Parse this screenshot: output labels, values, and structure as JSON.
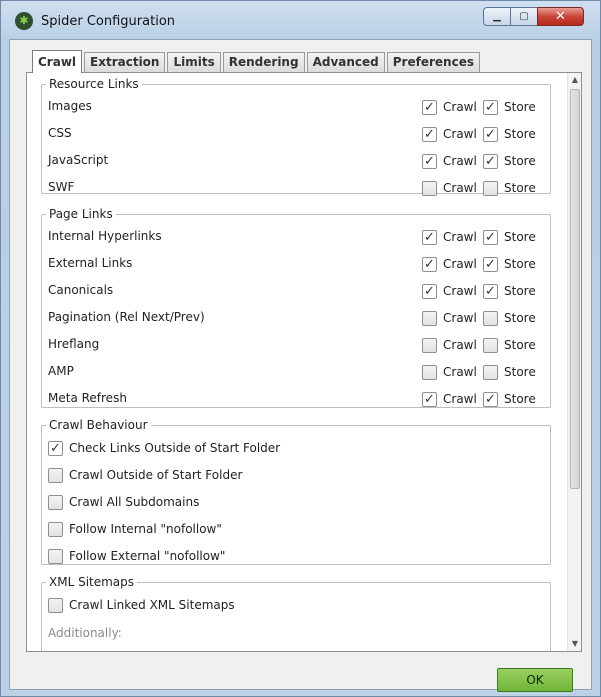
{
  "window": {
    "title": "Spider Configuration",
    "app_icon": "spider-icon"
  },
  "tabs": [
    {
      "label": "Crawl",
      "active": true
    },
    {
      "label": "Extraction",
      "active": false
    },
    {
      "label": "Limits",
      "active": false
    },
    {
      "label": "Rendering",
      "active": false
    },
    {
      "label": "Advanced",
      "active": false
    },
    {
      "label": "Preferences",
      "active": false
    }
  ],
  "resource_links": {
    "title": "Resource Links",
    "crawl_label": "Crawl",
    "store_label": "Store",
    "items": [
      {
        "label": "Images",
        "crawl": true,
        "store": true
      },
      {
        "label": "CSS",
        "crawl": true,
        "store": true
      },
      {
        "label": "JavaScript",
        "crawl": true,
        "store": true
      },
      {
        "label": "SWF",
        "crawl": false,
        "store": false
      }
    ]
  },
  "page_links": {
    "title": "Page Links",
    "crawl_label": "Crawl",
    "store_label": "Store",
    "items": [
      {
        "label": "Internal Hyperlinks",
        "crawl": true,
        "store": true
      },
      {
        "label": "External Links",
        "crawl": true,
        "store": true
      },
      {
        "label": "Canonicals",
        "crawl": true,
        "store": true
      },
      {
        "label": "Pagination (Rel Next/Prev)",
        "crawl": false,
        "store": false
      },
      {
        "label": "Hreflang",
        "crawl": false,
        "store": false
      },
      {
        "label": "AMP",
        "crawl": false,
        "store": false
      },
      {
        "label": "Meta Refresh",
        "crawl": true,
        "store": true
      }
    ]
  },
  "crawl_behaviour": {
    "title": "Crawl Behaviour",
    "items": [
      {
        "label": "Check Links Outside of Start Folder",
        "checked": true
      },
      {
        "label": "Crawl Outside of Start Folder",
        "checked": false
      },
      {
        "label": "Crawl All Subdomains",
        "checked": false
      },
      {
        "label": "Follow Internal \"nofollow\"",
        "checked": false
      },
      {
        "label": "Follow External \"nofollow\"",
        "checked": false
      }
    ]
  },
  "xml_sitemaps": {
    "title": "XML Sitemaps",
    "items": [
      {
        "label": "Crawl Linked XML Sitemaps",
        "checked": false
      }
    ],
    "additionally_label": "Additionally:"
  },
  "footer": {
    "ok_label": "OK"
  },
  "colors": {
    "ok_green": "#7dbf45",
    "close_red": "#c9453a"
  }
}
